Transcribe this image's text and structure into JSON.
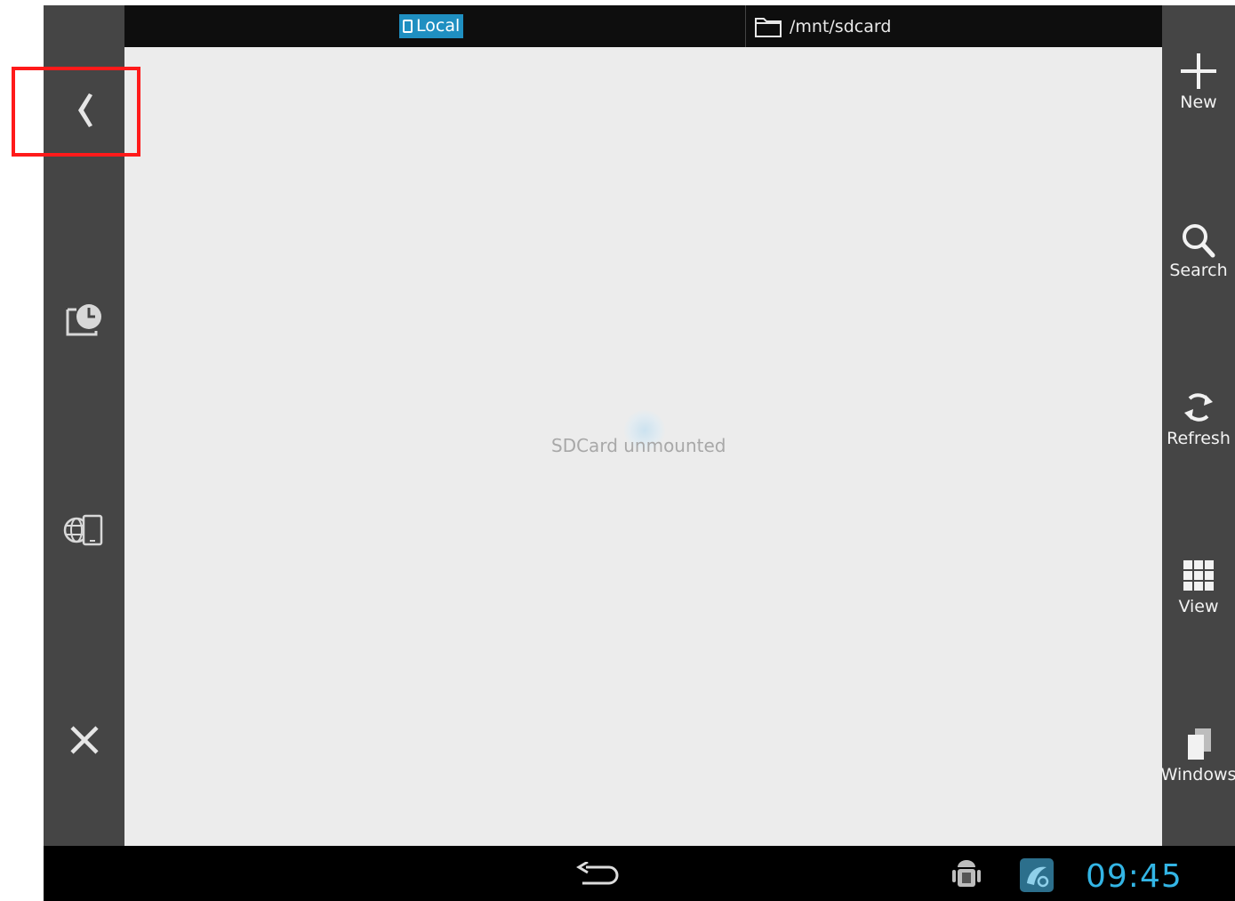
{
  "header": {
    "location_tab": "Local",
    "path": "/mnt/sdcard"
  },
  "main": {
    "empty_message": "SDCard unmounted"
  },
  "left_sidebar": {
    "icons": [
      "collapse-chevron-icon",
      "recent-history-icon",
      "network-device-icon",
      "close-icon"
    ]
  },
  "right_toolbar": {
    "new_label": "New",
    "search_label": "Search",
    "refresh_label": "Refresh",
    "view_label": "View",
    "windows_label": "Windows"
  },
  "system_bar": {
    "time": "09:45"
  },
  "colors": {
    "accent": "#33b5e5",
    "tab_highlight": "#1f8fc1",
    "sidebar_bg": "#454545",
    "content_bg": "#ececec",
    "annotation_box": "#ff1a1a"
  }
}
